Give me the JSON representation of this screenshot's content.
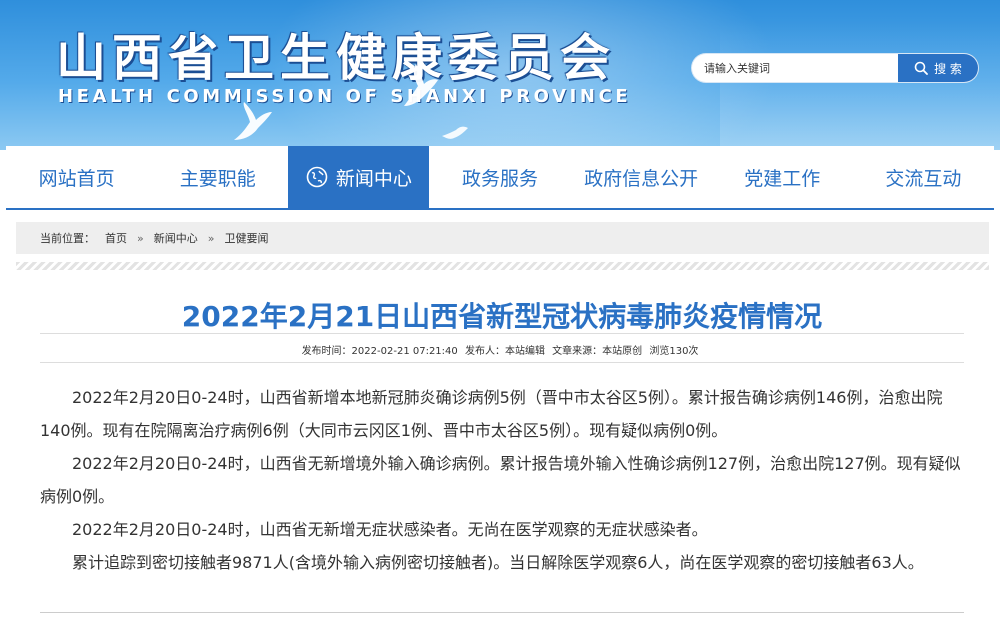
{
  "header": {
    "title": "山西省卫生健康委员会",
    "subtitle": "HEALTH COMMISSION OF SHANXI PROVINCE"
  },
  "search": {
    "placeholder": "请输入关键词",
    "button_label": "搜 索"
  },
  "nav": {
    "items": [
      {
        "label": "网站首页"
      },
      {
        "label": "主要职能"
      },
      {
        "label": "新闻中心"
      },
      {
        "label": "政务服务"
      },
      {
        "label": "政府信息公开"
      },
      {
        "label": "党建工作"
      },
      {
        "label": "交流互动"
      }
    ],
    "active_index": 2
  },
  "breadcrumb": {
    "prefix": "当前位置：",
    "items": [
      "首页",
      "新闻中心",
      "卫健要闻"
    ],
    "separator": "»"
  },
  "article": {
    "title": "2022年2月21日山西省新型冠状病毒肺炎疫情情况",
    "meta": {
      "publish_time": "发布时间：2022-02-21 07:21:40",
      "publisher": "发布人：本站编辑",
      "source": "文章来源：本站原创",
      "views": "浏览130次"
    },
    "paragraphs": [
      "2022年2月20日0-24时，山西省新增本地新冠肺炎确诊病例5例（晋中市太谷区5例）。累计报告确诊病例146例，治愈出院140例。现有在院隔离治疗病例6例（大同市云冈区1例、晋中市太谷区5例）。现有疑似病例0例。",
      "2022年2月20日0-24时，山西省无新增境外输入确诊病例。累计报告境外输入性确诊病例127例，治愈出院127例。现有疑似病例0例。",
      "2022年2月20日0-24时，山西省无新增无症状感染者。无尚在医学观察的无症状感染者。",
      "累计追踪到密切接触者9871人(含境外输入病例密切接触者)。当日解除医学观察6人，尚在医学观察的密切接触者63人。"
    ]
  },
  "colors": {
    "brand_blue": "#2a71c4",
    "header_blue": "#3f9ae2",
    "breadcrumb_bg": "#eeeeee",
    "body_text": "#333333"
  },
  "icons": [
    "dove-icon",
    "search-icon",
    "globe-icon"
  ]
}
